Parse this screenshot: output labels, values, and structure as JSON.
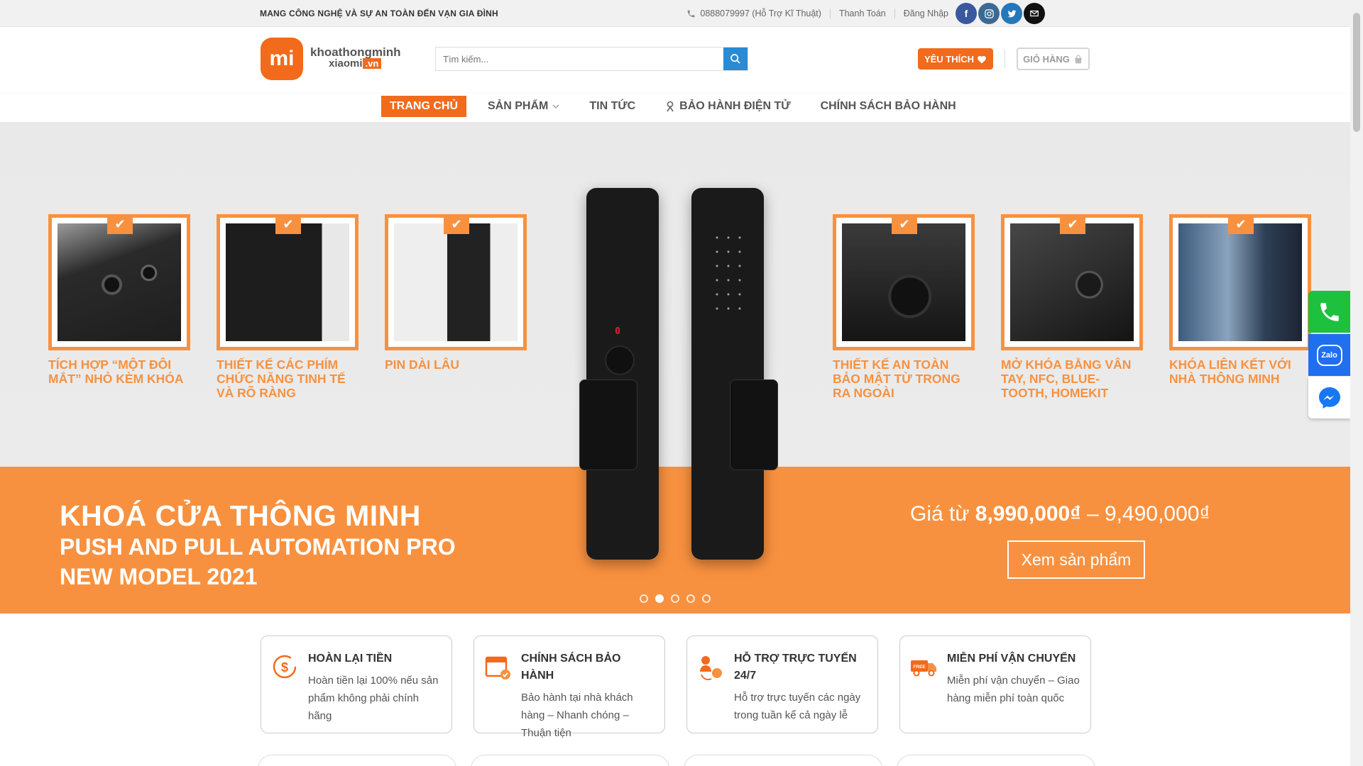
{
  "topbar": {
    "slogan": "MANG CÔNG NGHỆ VÀ SỰ AN TOÀN ĐẾN VẠN GIA ĐÌNH",
    "phone": "0888079997 (Hỗ Trợ Kĩ Thuật)",
    "payment": "Thanh Toán",
    "login": "Đăng Nhập",
    "social": [
      "facebook-icon",
      "instagram-icon",
      "twitter-icon",
      "email-icon"
    ]
  },
  "header": {
    "logo_mark": "mi",
    "logo_line1": "khoathongminh",
    "logo_line2": "xiaomi",
    "logo_tld": ".vn",
    "search_placeholder": "Tìm kiếm...",
    "favorites": "YÊU THÍCH",
    "cart": "GIỎ HÀNG"
  },
  "nav": {
    "home": "TRANG CHỦ",
    "products": "SẢN PHẨM",
    "news": "TIN TỨC",
    "warranty_e": "BẢO HÀNH ĐIỆN TỬ",
    "warranty_policy": "CHÍNH SÁCH BẢO HÀNH"
  },
  "hero": {
    "features": [
      "TÍCH HỢP “MỘT ĐÔI MẮT” NHỎ KÈM KHÓA",
      "THIẾT KẾ CÁC PHÍM CHỨC NĂNG TINH TẾ VÀ RÕ RÀNG",
      "PIN DÀI LÂU",
      "THIẾT KẾ AN TOÀN BẢO MẬT TỪ TRONG RA NGOÀI",
      "MỞ KHÓA BẰNG VÂN TAY, NFC, BLUE-TOOTH, HOMEKIT",
      "KHÓA LIÊN KẾT VỚI NHÀ THÔNG MINH"
    ],
    "title1": "KHOÁ CỬA THÔNG MINH",
    "title2": "PUSH AND PULL AUTOMATION PRO",
    "title3": "NEW MODEL 2021",
    "price_prefix": "Giá từ ",
    "price_from": "8,990,000₫",
    "price_sep": " – ",
    "price_to": "9,490,000₫",
    "cta": "Xem sản phẩm",
    "slide_count": 5,
    "active_slide": 2
  },
  "policies": [
    {
      "title": "HOÀN LẠI TIỀN",
      "text": "Hoàn tiền lại 100% nếu sản phẩm không phải chính hãng",
      "icon": "money-back-icon"
    },
    {
      "title": "CHÍNH SÁCH BẢO HÀNH",
      "text": "Bảo hành tại nhà khách hàng – Nhanh chóng – Thuận tiện",
      "icon": "calendar-check-icon"
    },
    {
      "title": "HỖ TRỢ TRỰC TUYẾN 24/7",
      "text": "Hỗ trợ trực tuyến các ngày trong tuần kể cả ngày lễ",
      "icon": "support-icon"
    },
    {
      "title": "MIỄN PHÍ VẬN CHUYỂN",
      "text": "Miễn phí vận chuyển – Giao hàng miễn phí toàn quốc",
      "icon": "free-shipping-icon"
    }
  ],
  "floating": {
    "zalo": "Zalo"
  },
  "colors": {
    "accent": "#f26a1b",
    "band": "#f8913f",
    "search": "#2a8ad3"
  }
}
